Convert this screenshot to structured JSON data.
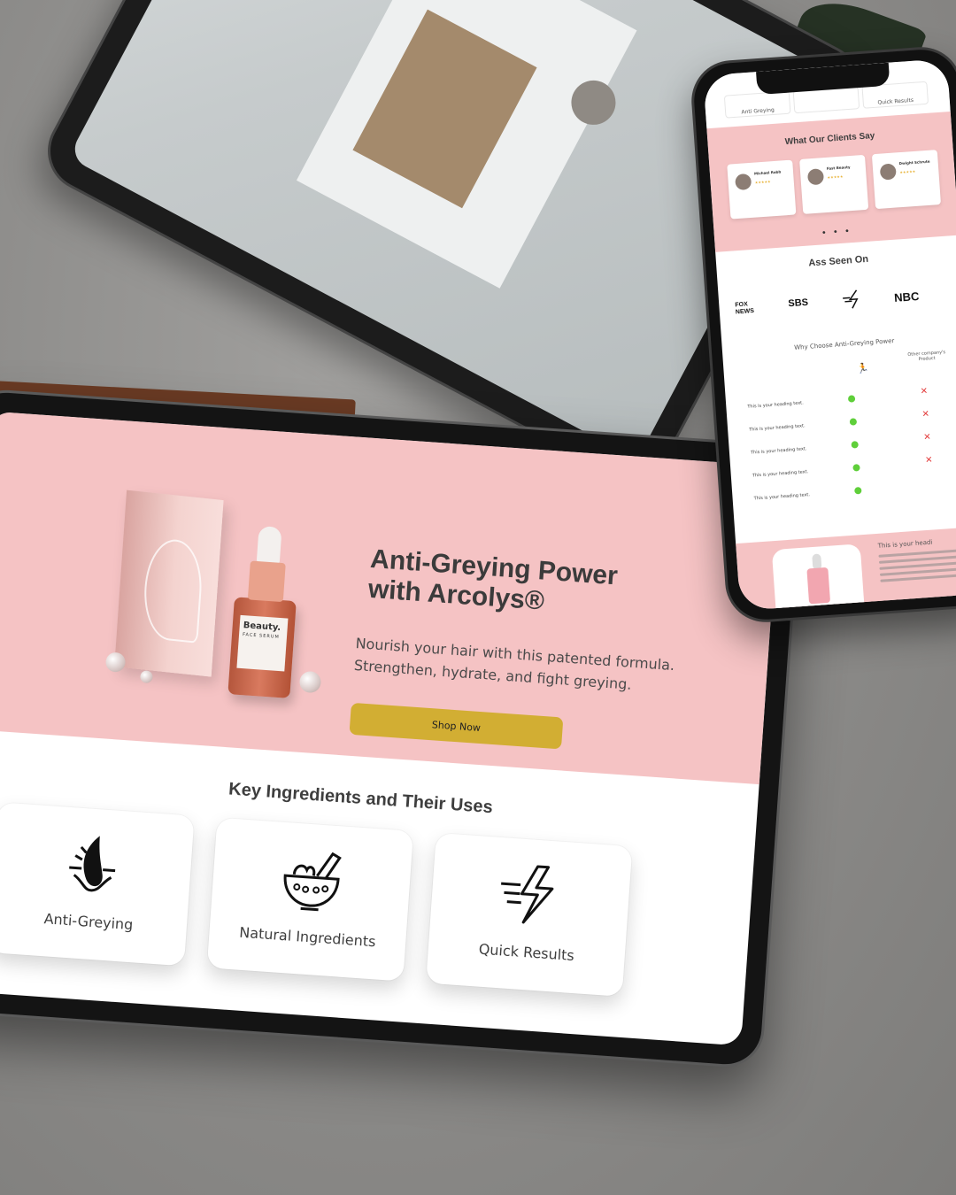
{
  "hero": {
    "title": "Anti-Greying Power with Arcolys®",
    "subtitle": "Nourish your hair with this patented formula. Strengthen, hydrate, and fight greying.",
    "cta_label": "Shop Now",
    "product": {
      "brand": "Beauty.",
      "product_name": "FACE SERUM"
    }
  },
  "ingredients": {
    "section_title": "Key Ingredients and Their Uses",
    "cards": [
      {
        "label": "Anti-Greying",
        "icon": "hair-follicle-icon"
      },
      {
        "label": "Natural Ingredients",
        "icon": "mortar-pestle-icon"
      },
      {
        "label": "Quick Results",
        "icon": "lightning-icon"
      }
    ]
  },
  "phone": {
    "nav_tabs": [
      "Anti Greying",
      "",
      "Quick Results"
    ],
    "testimonials_title": "What Our Clients Say",
    "reviews": [
      {
        "name": "Michael Robb",
        "stars": "★★★★★"
      },
      {
        "name": "Fast Beauty",
        "stars": "★★★★★"
      },
      {
        "name": "Dwight Schrute",
        "stars": "★★★★★"
      }
    ],
    "carousel_dots": "• • •",
    "seen_on_title": "Ass Seen On",
    "logos": [
      "FOX NEWS",
      "SBS",
      "NBC"
    ],
    "comparison_title": "Why Choose Anti-Greying Power",
    "comparison_other": "Other company's Product",
    "comparison_rows": [
      "This is your heading text.",
      "This is your heading text.",
      "This is your heading text.",
      "This is your heading text.",
      "This is your heading text."
    ],
    "promo_heading": "This is your headi"
  },
  "colors": {
    "hero_pink": "#f5c3c4",
    "cta_gold": "#d2ae33",
    "text_dark": "#3b3b3b",
    "check_green": "#5fcf3a",
    "cross_red": "#e23a3a"
  }
}
